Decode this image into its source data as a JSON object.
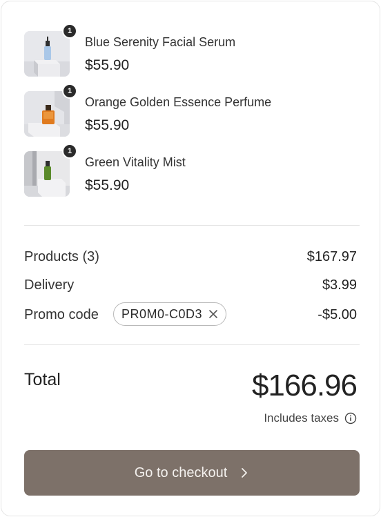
{
  "cart": {
    "items": [
      {
        "name": "Blue Serenity Facial Serum",
        "price": "$55.90",
        "qty": "1",
        "image": "serum-bottle-image"
      },
      {
        "name": "Orange Golden Essence Perfume",
        "price": "$55.90",
        "qty": "1",
        "image": "perfume-bottle-image"
      },
      {
        "name": "Green Vitality Mist",
        "price": "$55.90",
        "qty": "1",
        "image": "mist-bottle-image"
      }
    ]
  },
  "summary": {
    "products_label": "Products (3)",
    "products_value": "$167.97",
    "delivery_label": "Delivery",
    "delivery_value": "$3.99",
    "promo_label": "Promo code",
    "promo_code": "PR0M0-C0D3",
    "promo_value": "-$5.00"
  },
  "total": {
    "label": "Total",
    "value": "$166.96",
    "taxes_note": "Includes taxes"
  },
  "checkout": {
    "label": "Go to checkout"
  },
  "colors": {
    "accent": "#7d7169",
    "badge": "#2a2a2a",
    "border": "#e4e4e4"
  }
}
